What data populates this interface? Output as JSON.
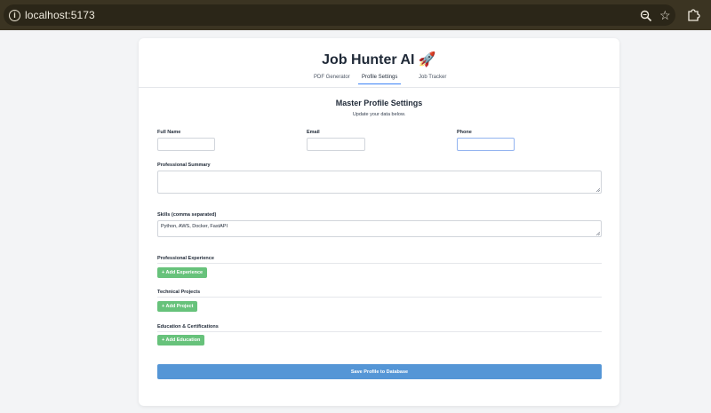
{
  "browser": {
    "url": "localhost:5173",
    "icons": [
      "info-icon",
      "zoom-icon",
      "star-icon",
      "extensions-icon"
    ]
  },
  "app": {
    "title": "Job Hunter AI 🚀",
    "tabs": [
      {
        "label": "PDF Generator",
        "active": false
      },
      {
        "label": "Profile Settings",
        "active": true
      },
      {
        "label": "Job Tracker",
        "active": false
      }
    ]
  },
  "profile": {
    "heading": "Master Profile Settings",
    "subheading": "Update your data below.",
    "fields": {
      "full_name": {
        "label": "Full Name",
        "value": ""
      },
      "email": {
        "label": "Email",
        "value": ""
      },
      "phone": {
        "label": "Phone",
        "value": ""
      },
      "summary": {
        "label": "Professional Summary",
        "value": ""
      },
      "skills": {
        "label": "Skills (comma separated)",
        "value": "Python, AWS, Docker, FastAPI"
      }
    },
    "sections": {
      "experience": {
        "title": "Professional Experience",
        "button": "+ Add Experience"
      },
      "projects": {
        "title": "Technical Projects",
        "button": "+ Add Project"
      },
      "education": {
        "title": "Education & Certifications",
        "button": "+ Add Education"
      }
    },
    "save_button": "Save Profile to Database"
  },
  "colors": {
    "accent_tab": "#3b82f6",
    "add_button": "#67c27b",
    "save_button": "#5596d6",
    "browser_bar": "#3b3422"
  }
}
